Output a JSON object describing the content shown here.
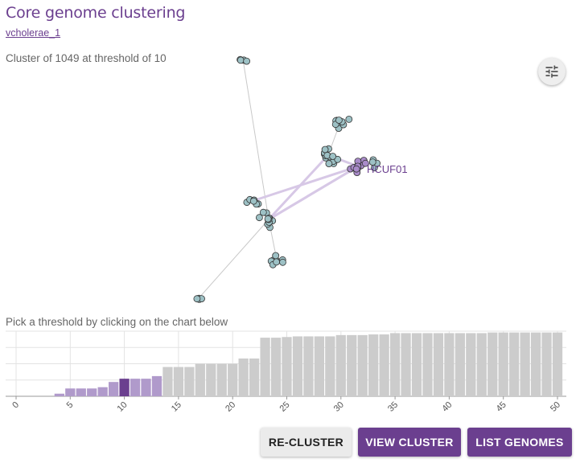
{
  "header": {
    "title": "Core genome clustering",
    "dataset_link": "vcholerae_1",
    "subtitle": "Cluster of 1049 at threshold of 10"
  },
  "network": {
    "highlight_label": "HCUF01",
    "colors": {
      "node": "#9dc1c5",
      "node_highlight": "#a98bc9",
      "edge": "#c9c9c9",
      "edge_highlight": "#d7c8e6"
    }
  },
  "histogram": {
    "prompt": "Pick a threshold by clicking on the chart below",
    "selected_threshold": 10,
    "colors": {
      "selected": "#6b3f8f",
      "in_cluster": "#b09acb",
      "other": "#cccccc"
    }
  },
  "chart_data": {
    "type": "bar",
    "x_ticks": [
      "0",
      "5",
      "10",
      "15",
      "20",
      "25",
      "30",
      "35",
      "40",
      "45",
      "50"
    ],
    "x": [
      1,
      2,
      3,
      4,
      5,
      6,
      7,
      8,
      9,
      10,
      11,
      12,
      13,
      14,
      15,
      16,
      17,
      18,
      19,
      20,
      21,
      22,
      23,
      24,
      25,
      26,
      27,
      28,
      29,
      30,
      31,
      32,
      33,
      34,
      35,
      36,
      37,
      38,
      39,
      40,
      41,
      42,
      43,
      44,
      45,
      46,
      47,
      48,
      49,
      50
    ],
    "values": [
      0,
      0,
      0,
      0.04,
      0.12,
      0.12,
      0.12,
      0.14,
      0.22,
      0.27,
      0.27,
      0.27,
      0.31,
      0.45,
      0.45,
      0.45,
      0.5,
      0.5,
      0.5,
      0.5,
      0.58,
      0.58,
      0.9,
      0.9,
      0.91,
      0.92,
      0.92,
      0.92,
      0.92,
      0.94,
      0.94,
      0.94,
      0.95,
      0.95,
      0.97,
      0.97,
      0.97,
      0.97,
      0.97,
      0.97,
      0.97,
      0.97,
      0.97,
      0.98,
      0.98,
      0.98,
      0.98,
      0.98,
      0.98,
      0.98
    ],
    "ylim": [
      0,
      1
    ],
    "grid": true
  },
  "actions": {
    "recluster": "RE-CLUSTER",
    "view_cluster": "VIEW CLUSTER",
    "list_genomes": "LIST GENOMES"
  }
}
